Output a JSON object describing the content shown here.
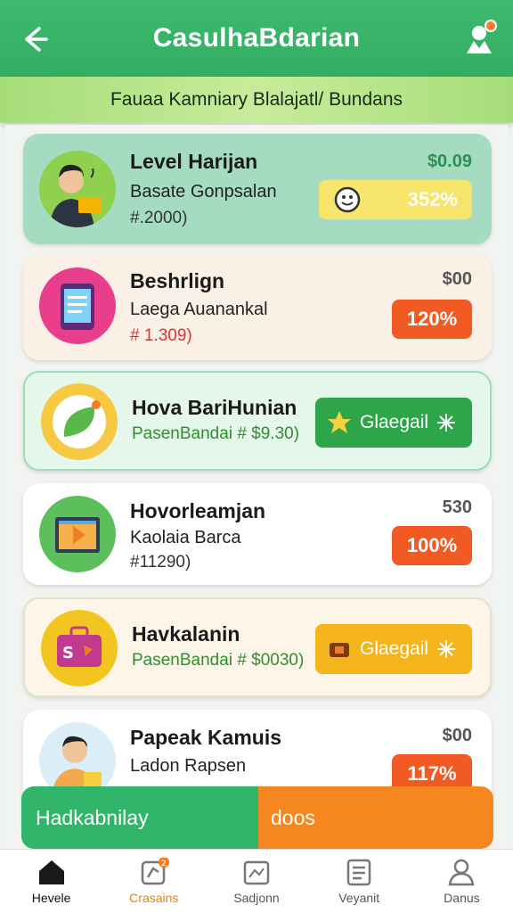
{
  "header": {
    "title": "CasulhaBdarian"
  },
  "banner": {
    "text": "Fauaa Kamniary Blalajatl/ Bundans"
  },
  "cards": [
    {
      "title": "Level Harijan",
      "subtitle": "Basate Gonpsalan",
      "amount": "#.2000)",
      "price": "$0.09",
      "action": "352%"
    },
    {
      "title": "Beshrlign",
      "subtitle": "Laega Auanankal",
      "amount": "# 1.309)",
      "price": "$00",
      "action": "120%"
    },
    {
      "title": "Hova BariHunian",
      "subtitle": "PasenBandai # $9.30)",
      "action": "Glaegail"
    },
    {
      "title": "Hovorleamjan",
      "subtitle": "Kaolaia Barca",
      "amount": "#11290)",
      "price": "530",
      "action": "100%"
    },
    {
      "title": "Havkalanin",
      "subtitle": "PasenBandai # $0030)",
      "action": "Glaegail"
    },
    {
      "title": "Papeak Kamuis",
      "subtitle": "Ladon Rapsen",
      "price": "$00",
      "action": "117%"
    }
  ],
  "bottom_buttons": {
    "left": "Hadkabnilay",
    "right": "doos"
  },
  "tabs": [
    {
      "label": "Hevele"
    },
    {
      "label": "Crasains",
      "badge": "2"
    },
    {
      "label": "Sadjonn"
    },
    {
      "label": "Veyanit"
    },
    {
      "label": "Danus"
    }
  ],
  "colors": {
    "primary": "#33ad63",
    "accent_orange": "#f15a22",
    "yellow": "#f5c518",
    "bottom_orange": "#f6861f"
  }
}
